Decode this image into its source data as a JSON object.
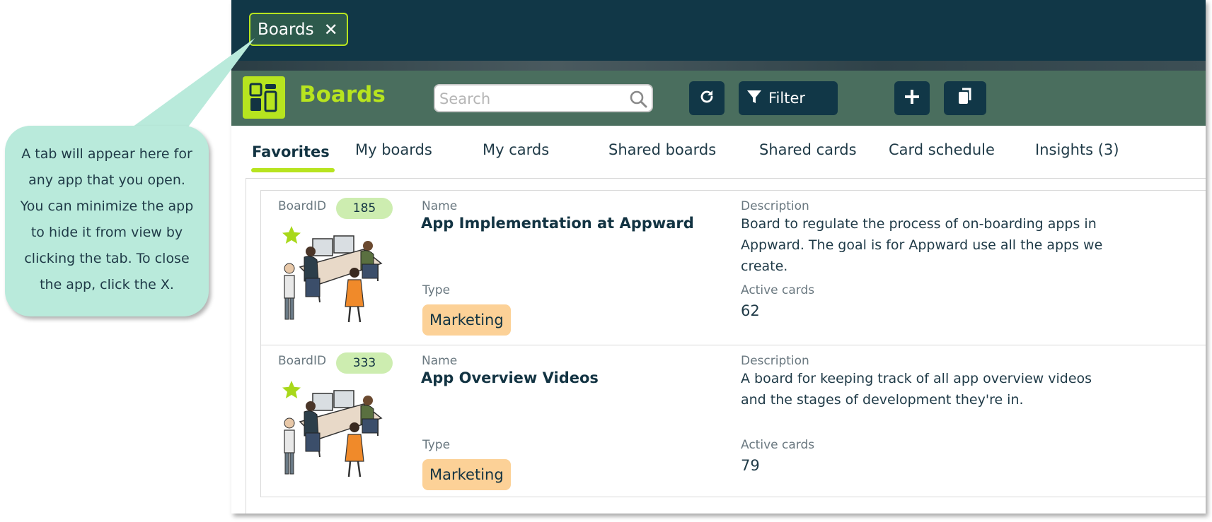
{
  "window_tab": {
    "label": "Boards",
    "close_symbol": "✕"
  },
  "header": {
    "title": "Boards",
    "search_placeholder": "Search",
    "filter_label": "Filter"
  },
  "nav": {
    "tabs": [
      "Favorites",
      "My boards",
      "My cards",
      "Shared boards",
      "Shared cards",
      "Card schedule",
      "Insights (3)"
    ],
    "active": "Favorites"
  },
  "labels": {
    "board_id": "BoardID",
    "name": "Name",
    "description": "Description",
    "type": "Type",
    "active_cards": "Active cards"
  },
  "boards": [
    {
      "id": "185",
      "name": "App Implementation at Appward",
      "description": "Board to regulate the process of on-boarding apps in Appward.  The goal is for Appward use all the apps we create.",
      "type": "Marketing",
      "active_cards": "62",
      "favorite": true
    },
    {
      "id": "333",
      "name": "App Overview Videos",
      "description": "A board for keeping track of all app overview videos and the stages of development they're in.",
      "type": "Marketing",
      "active_cards": "79",
      "favorite": true
    }
  ],
  "callout": {
    "text": "A tab will appear here for any app that you open. You can minimize the app to hide it from view by clicking the tab. To close the app, click the X."
  },
  "colors": {
    "dark_teal": "#113747",
    "header_green": "#4a6e5e",
    "accent_lime": "#b7e41f",
    "badge_green": "#cdedb0",
    "tag_orange": "#fcd197",
    "callout_mint": "#b9eadb"
  },
  "icons": {
    "logo": "boards-app-icon",
    "search": "search-icon",
    "refresh": "refresh-icon",
    "filter": "filter-icon",
    "add": "plus-icon",
    "copy": "copy-icon",
    "favorite": "star-icon"
  }
}
